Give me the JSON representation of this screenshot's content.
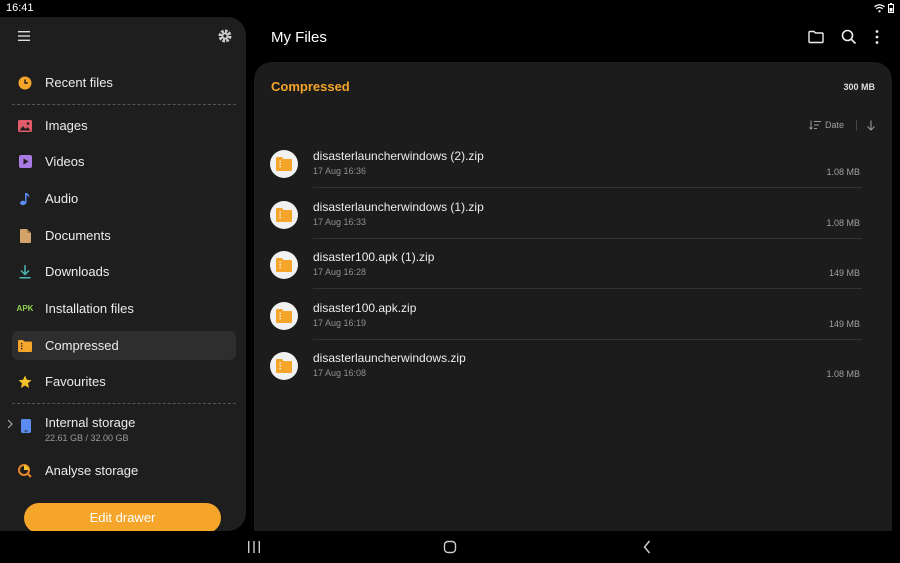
{
  "status": {
    "time": "16:41"
  },
  "drawer": {
    "items_top": [
      {
        "label": "Recent files",
        "icon": "clock-icon"
      }
    ],
    "items_categories": [
      {
        "label": "Images",
        "icon": "image-icon"
      },
      {
        "label": "Videos",
        "icon": "video-icon"
      },
      {
        "label": "Audio",
        "icon": "music-note-icon"
      },
      {
        "label": "Documents",
        "icon": "document-icon"
      },
      {
        "label": "Downloads",
        "icon": "download-icon"
      },
      {
        "label": "Installation files",
        "icon": "apk-icon",
        "icon_text": "APK"
      },
      {
        "label": "Compressed",
        "icon": "zip-folder-icon",
        "active": true
      },
      {
        "label": "Favourites",
        "icon": "star-icon"
      }
    ],
    "storage": {
      "label": "Internal storage",
      "usage": "22.61 GB / 32.00 GB"
    },
    "analyse": {
      "label": "Analyse storage"
    },
    "edit_button": "Edit drawer"
  },
  "header": {
    "title": "My Files"
  },
  "folder": {
    "title": "Compressed",
    "size": "300 MB",
    "sort_label": "Date"
  },
  "files": [
    {
      "name": "disasterlauncherwindows (2).zip",
      "date": "17 Aug 16:36",
      "size": "1.08 MB"
    },
    {
      "name": "disasterlauncherwindows (1).zip",
      "date": "17 Aug 16:33",
      "size": "1.08 MB"
    },
    {
      "name": "disaster100.apk (1).zip",
      "date": "17 Aug 16:28",
      "size": "149 MB"
    },
    {
      "name": "disaster100.apk.zip",
      "date": "17 Aug 16:19",
      "size": "149 MB"
    },
    {
      "name": "disasterlauncherwindows.zip",
      "date": "17 Aug 16:08",
      "size": "1.08 MB"
    }
  ],
  "colors": {
    "accent": "#f4a52a",
    "background": "#000000",
    "panel": "#1c1c1c",
    "drawer": "#1e1e1e"
  }
}
